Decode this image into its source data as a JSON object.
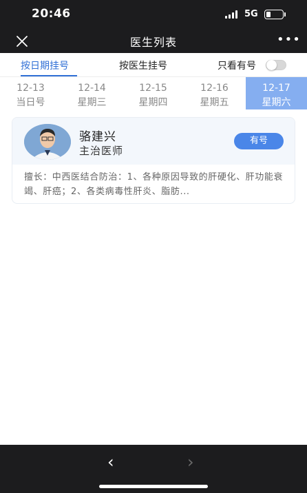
{
  "status_bar": {
    "time": "20:46",
    "network": "5G",
    "battery_level": 0.25
  },
  "nav": {
    "title": "医生列表",
    "close_icon": "close-icon",
    "more_icon": "more-icon",
    "more_glyph": "•••"
  },
  "tabs": {
    "by_date": "按日期挂号",
    "by_doctor": "按医生挂号",
    "available_only": "只看有号",
    "available_only_on": false
  },
  "dates": [
    {
      "date": "12-13",
      "weekday": "当日号"
    },
    {
      "date": "12-14",
      "weekday": "星期三"
    },
    {
      "date": "12-15",
      "weekday": "星期四"
    },
    {
      "date": "12-16",
      "weekday": "星期五"
    },
    {
      "date": "12-17",
      "weekday": "星期六",
      "selected": true
    }
  ],
  "doctor": {
    "name": "骆建兴",
    "title": "主治医师",
    "availability": "有号",
    "specialty": "擅长：中西医结合防治：1、各种原因导致的肝硬化、肝功能衰竭、肝癌；2、各类病毒性肝炎、脂肪..."
  },
  "bottom_bar": {
    "back_glyph": "‹",
    "forward_glyph": "›"
  },
  "colors": {
    "accent": "#2f6fd6",
    "selected_date_bg": "#85aef0",
    "badge_bg": "#4a86e8",
    "bar_bg": "#1c1c1e"
  }
}
